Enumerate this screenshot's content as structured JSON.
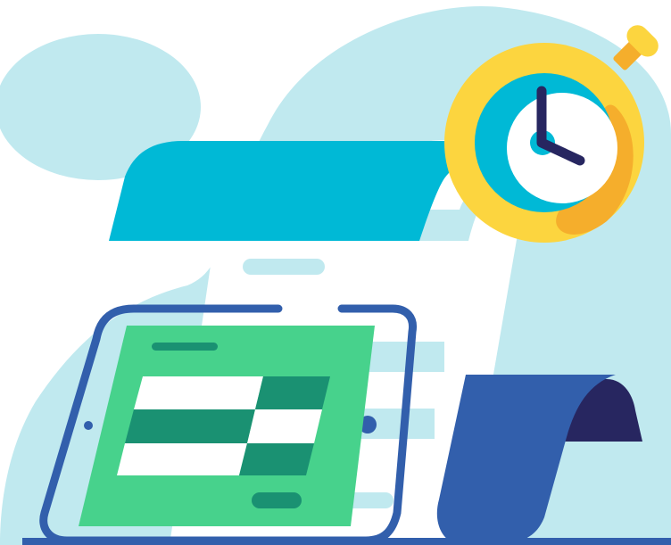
{
  "illustration": {
    "palette": {
      "background": "#ffffff",
      "blob": "#c0e9ef",
      "paper": "#ffffff",
      "paper_lines": "#c0e9ef",
      "scroll_top": "#00b9d6",
      "scroll_bottom": "#325fac",
      "scroll_shadow": "#272660",
      "stopwatch_ring": "#fcd53f",
      "stopwatch_ring_accent": "#f5ae2c",
      "stopwatch_inner": "#00b9d6",
      "stopwatch_hands": "#272660",
      "tablet_frame": "#325fac",
      "tablet_screen": "#47d28c",
      "spreadsheet_dark": "#1a9172",
      "spreadsheet_light": "#ffffff"
    },
    "icons": [
      "background-blob",
      "paper-scroll-icon",
      "stopwatch-icon",
      "tablet-icon",
      "spreadsheet-icon"
    ]
  }
}
